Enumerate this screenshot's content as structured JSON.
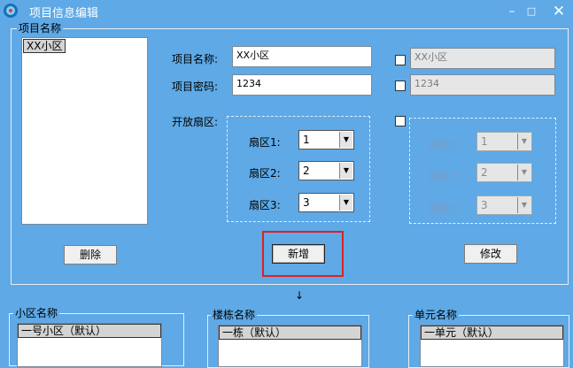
{
  "window": {
    "title": "项目信息编辑",
    "min_glyph": "–",
    "max_glyph": "□",
    "close_glyph": "✕"
  },
  "project_group": {
    "title": "项目名称",
    "list_items": [
      "XX小区"
    ]
  },
  "form": {
    "name_label": "项目名称:",
    "name_value": "XX小区",
    "password_label": "项目密码:",
    "password_value": "1234",
    "open_sectors_label": "开放扇区:",
    "sectors": [
      {
        "label": "扇区1:",
        "value": "1"
      },
      {
        "label": "扇区2:",
        "value": "2"
      },
      {
        "label": "扇区3:",
        "value": "3"
      }
    ]
  },
  "right_form": {
    "name_value": "XX小区",
    "password_value": "1234",
    "sectors": [
      {
        "label": "扇区1:",
        "value": "1"
      },
      {
        "label": "扇区2:",
        "value": "2"
      },
      {
        "label": "扇区3:",
        "value": "3"
      }
    ]
  },
  "buttons": {
    "delete": "删除",
    "add": "新增",
    "modify": "修改"
  },
  "arrow_glyph": "↓",
  "lower_groups": {
    "community": {
      "title": "小区名称",
      "items": [
        "一号小区（默认）"
      ]
    },
    "building": {
      "title": "楼栋名称",
      "items": [
        "一栋（默认）"
      ]
    },
    "unit": {
      "title": "单元名称",
      "items": [
        "一单元（默认）"
      ]
    }
  },
  "colors": {
    "background": "#5ea9e6",
    "highlight": "#e02020"
  }
}
